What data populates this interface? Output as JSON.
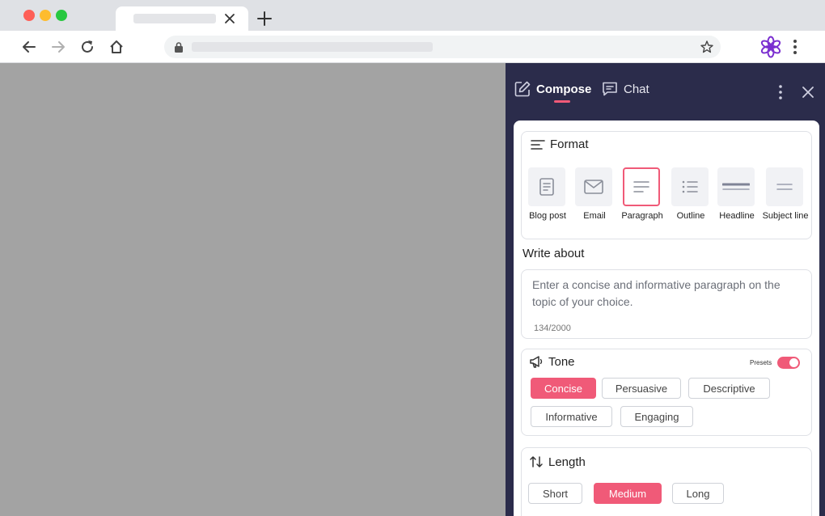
{
  "panel": {
    "tabs": [
      {
        "label": "Compose",
        "active": true
      },
      {
        "label": "Chat",
        "active": false
      }
    ]
  },
  "format": {
    "title": "Format",
    "items": [
      {
        "label": "Blog post",
        "icon": "document-icon"
      },
      {
        "label": "Email",
        "icon": "envelope-icon"
      },
      {
        "label": "Paragraph",
        "icon": "paragraph-icon",
        "selected": true
      },
      {
        "label": "Outline",
        "icon": "list-icon"
      },
      {
        "label": "Headline",
        "icon": "headline-icon"
      },
      {
        "label": "Subject line",
        "icon": "subject-line-icon"
      }
    ]
  },
  "write_about": {
    "title": "Write about",
    "text": "Enter a concise and informative paragraph on the topic of your choice.",
    "counter": "134/2000"
  },
  "tone": {
    "title": "Tone",
    "presets_label": "Presets",
    "presets_on": true,
    "options": [
      {
        "label": "Concise",
        "selected": true
      },
      {
        "label": "Persuasive",
        "selected": false
      },
      {
        "label": "Descriptive",
        "selected": false
      },
      {
        "label": "Informative",
        "selected": false
      },
      {
        "label": "Engaging",
        "selected": false
      }
    ]
  },
  "length": {
    "title": "Length",
    "options": [
      {
        "label": "Short",
        "selected": false
      },
      {
        "label": "Medium",
        "selected": true
      },
      {
        "label": "Long",
        "selected": false
      }
    ]
  },
  "colors": {
    "accent": "#f05a78",
    "panel_bg": "#2b2c4b",
    "page_bg": "#a3a3a3"
  }
}
